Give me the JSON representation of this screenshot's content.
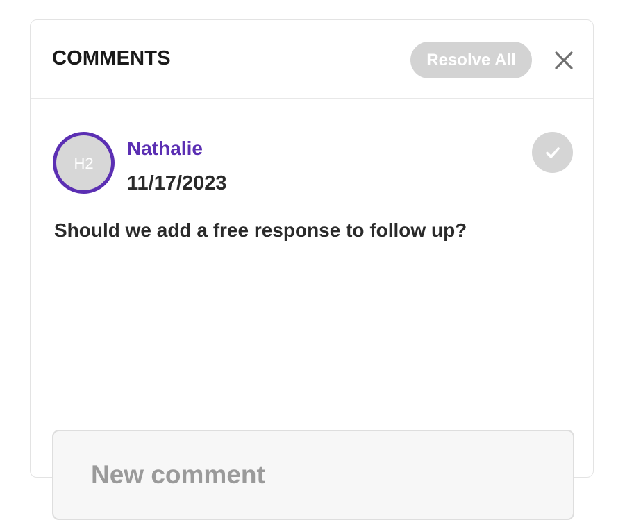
{
  "header": {
    "title": "COMMENTS",
    "resolve_all_label": "Resolve All",
    "close_icon": "close-icon"
  },
  "comment": {
    "avatar_initials": "H2",
    "author": "Nathalie",
    "date": "11/17/2023",
    "text": "Should we add a free response to follow up?",
    "resolve_icon": "check-icon"
  },
  "composer": {
    "placeholder": "New comment",
    "value": ""
  },
  "colors": {
    "accent": "#5b2fb3",
    "muted_button": "#d3d3d3",
    "text": "#2a2a2a"
  }
}
